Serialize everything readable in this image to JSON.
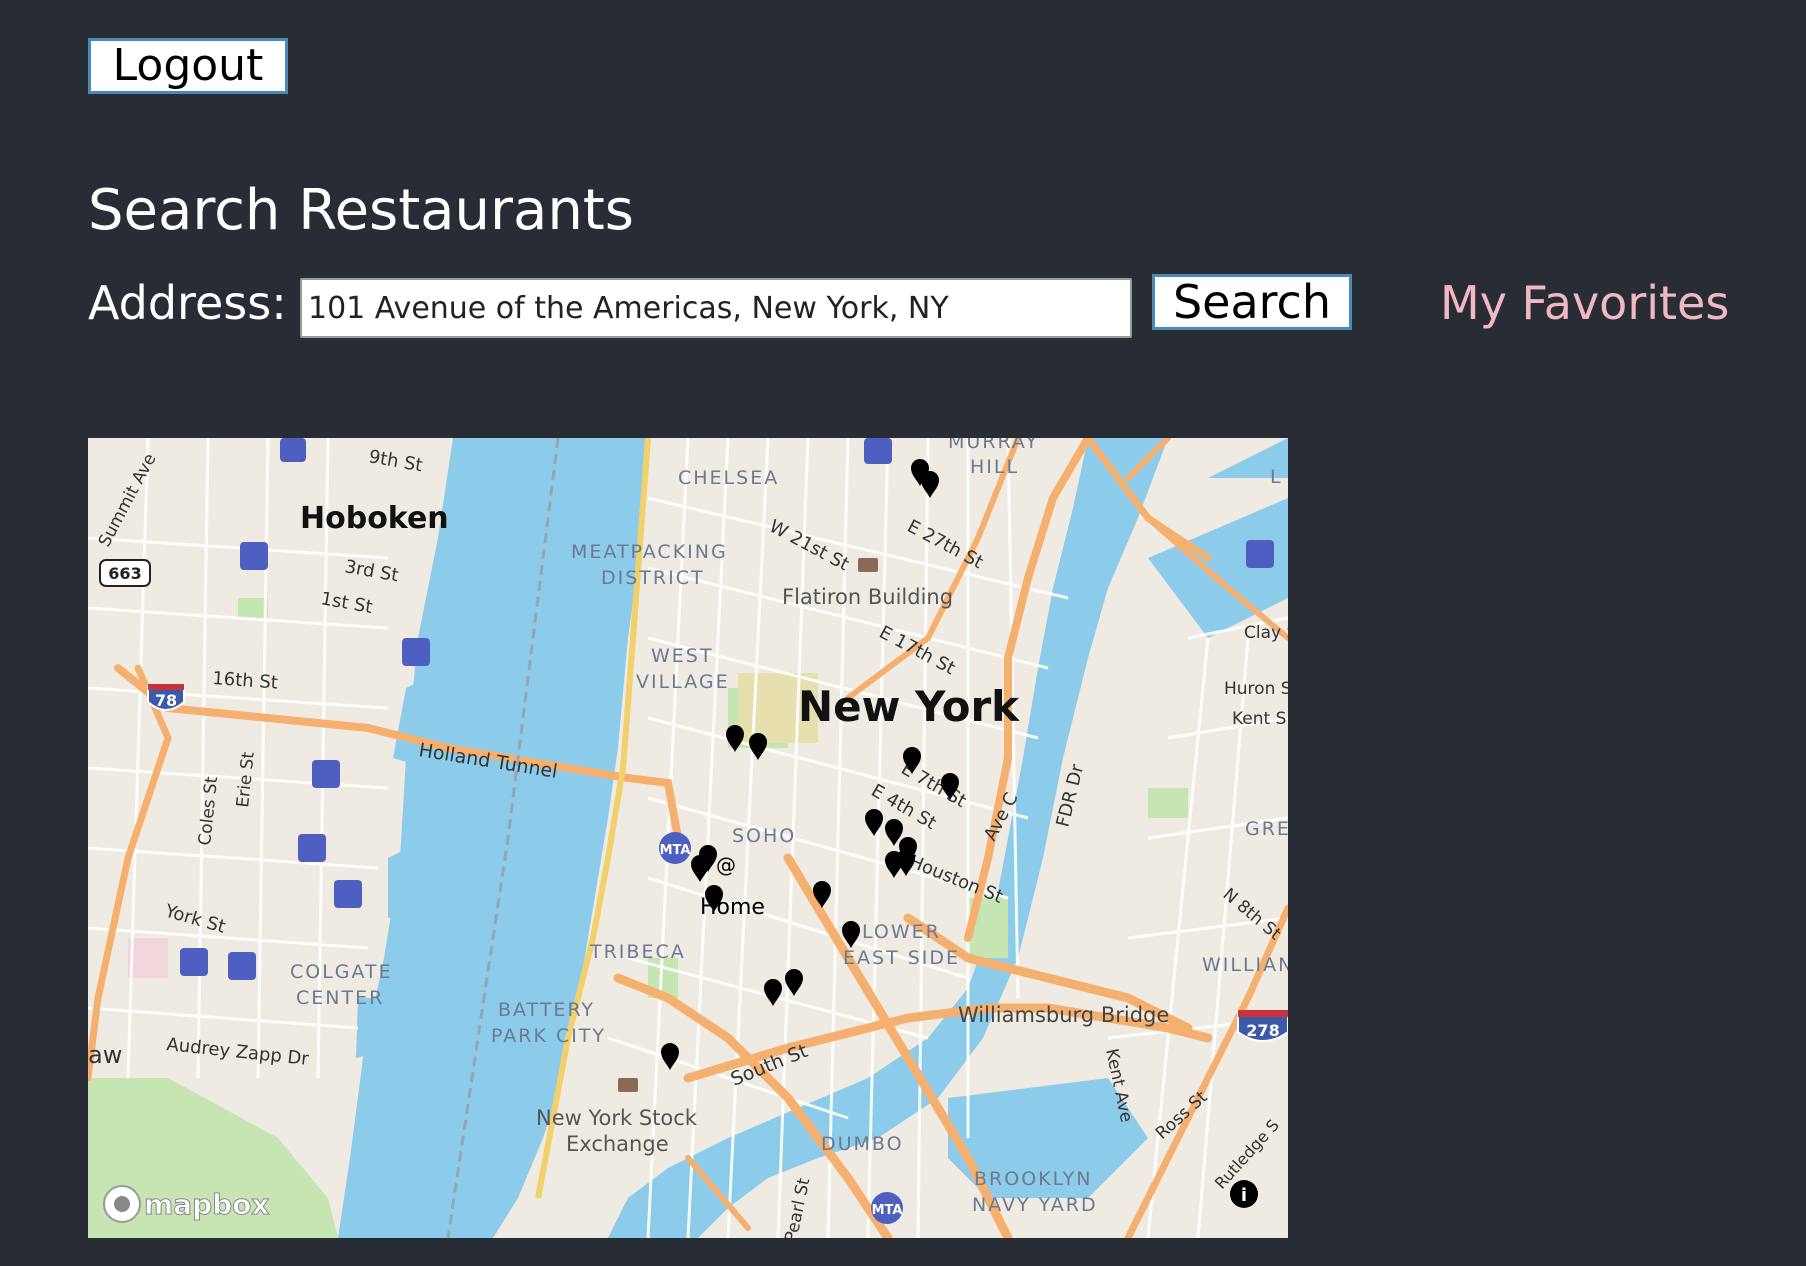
{
  "header": {
    "logout_label": "Logout"
  },
  "search": {
    "title": "Search Restaurants",
    "address_label": "Address:",
    "address_value": "101 Avenue of the Americas, New York, NY",
    "button_label": "Search",
    "favorites_label": "My Favorites"
  },
  "map": {
    "labels": {
      "hoboken": "Hoboken",
      "new_york": "New York",
      "chelsea": "CHELSEA",
      "murray": "MURRAY",
      "hill": "HILL",
      "meatpacking": "MEATPACKING",
      "district": "DISTRICT",
      "west": "WEST",
      "village": "VILLAGE",
      "soho": "SOHO",
      "tribeca": "TRIBECA",
      "battery": "BATTERY",
      "park_city": "PARK CITY",
      "lower": "LOWER",
      "east_side": "EAST SIDE",
      "colgate": "COLGATE",
      "center": "CENTER",
      "dumbo": "DUMBO",
      "brooklyn": "BROOKLYN",
      "navy_yard": "NAVY YARD",
      "flatiron": "Flatiron Building",
      "stock1": "New York Stock",
      "stock2": "Exchange",
      "williamsburg": "Williamsburg Bridge",
      "holland": "Holland Tunnel",
      "summit": "Summit Ave",
      "st9": "9th St",
      "st3": "3rd St",
      "st1": "1st St",
      "st16": "16th St",
      "w21": "W 21st St",
      "e27": "E 27th St",
      "e17": "E 17th St",
      "e4": "E 4th St",
      "e7": "E 7th St",
      "houston": "Houston St",
      "avec": "Ave C",
      "fdr": "FDR Dr",
      "coles": "Coles St",
      "erie": "Erie St",
      "york": "York St",
      "audrey": "Audrey Zapp Dr",
      "south": "South St",
      "kent_ave": "Kent Ave",
      "ross": "Ross St",
      "rutledge": "Rutledge S",
      "n8": "N 8th St",
      "clay": "Clay S",
      "huron": "Huron S",
      "kent": "Kent S",
      "gre": "GRE",
      "willian": "WILLIAN",
      "l": "L",
      "aw": "aw",
      "pearl": "Pearl St",
      "home": "Home",
      "at": "@",
      "shield_663": "663",
      "shield_78": "78",
      "shield_278": "278",
      "mta": "MTA",
      "mapbox": "mapbox",
      "info": "i"
    }
  }
}
